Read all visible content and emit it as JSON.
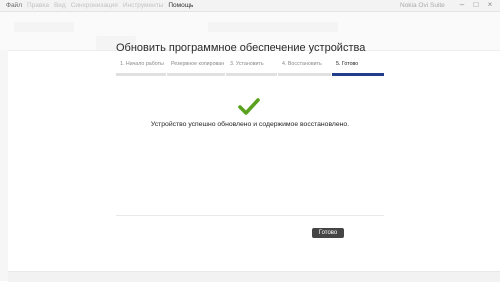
{
  "menubar": {
    "items": [
      "Файл",
      "Правка",
      "Вид",
      "Синхронизация",
      "Инструменты",
      "Помощь"
    ],
    "app_name": "Nokia Ovi Suite",
    "minimize": "–",
    "maximize": "□",
    "close": "×"
  },
  "wizard": {
    "title": "Обновить программное обеспечение устройства",
    "steps": [
      {
        "label": "1. Начало работы",
        "active": false
      },
      {
        "label": "Резервное копирован",
        "active": false
      },
      {
        "label": "3. Установить",
        "active": false
      },
      {
        "label": "4. Восстановить",
        "active": false
      },
      {
        "label": "5. Готово",
        "active": true
      }
    ],
    "message": "Устройство успешно обновлено и содержимое восстановлено.",
    "done_button": "Готово"
  },
  "colors": {
    "accent": "#223d8c",
    "check": "#5aa11e",
    "button": "#454545"
  },
  "icons": {
    "check": "check-icon"
  }
}
